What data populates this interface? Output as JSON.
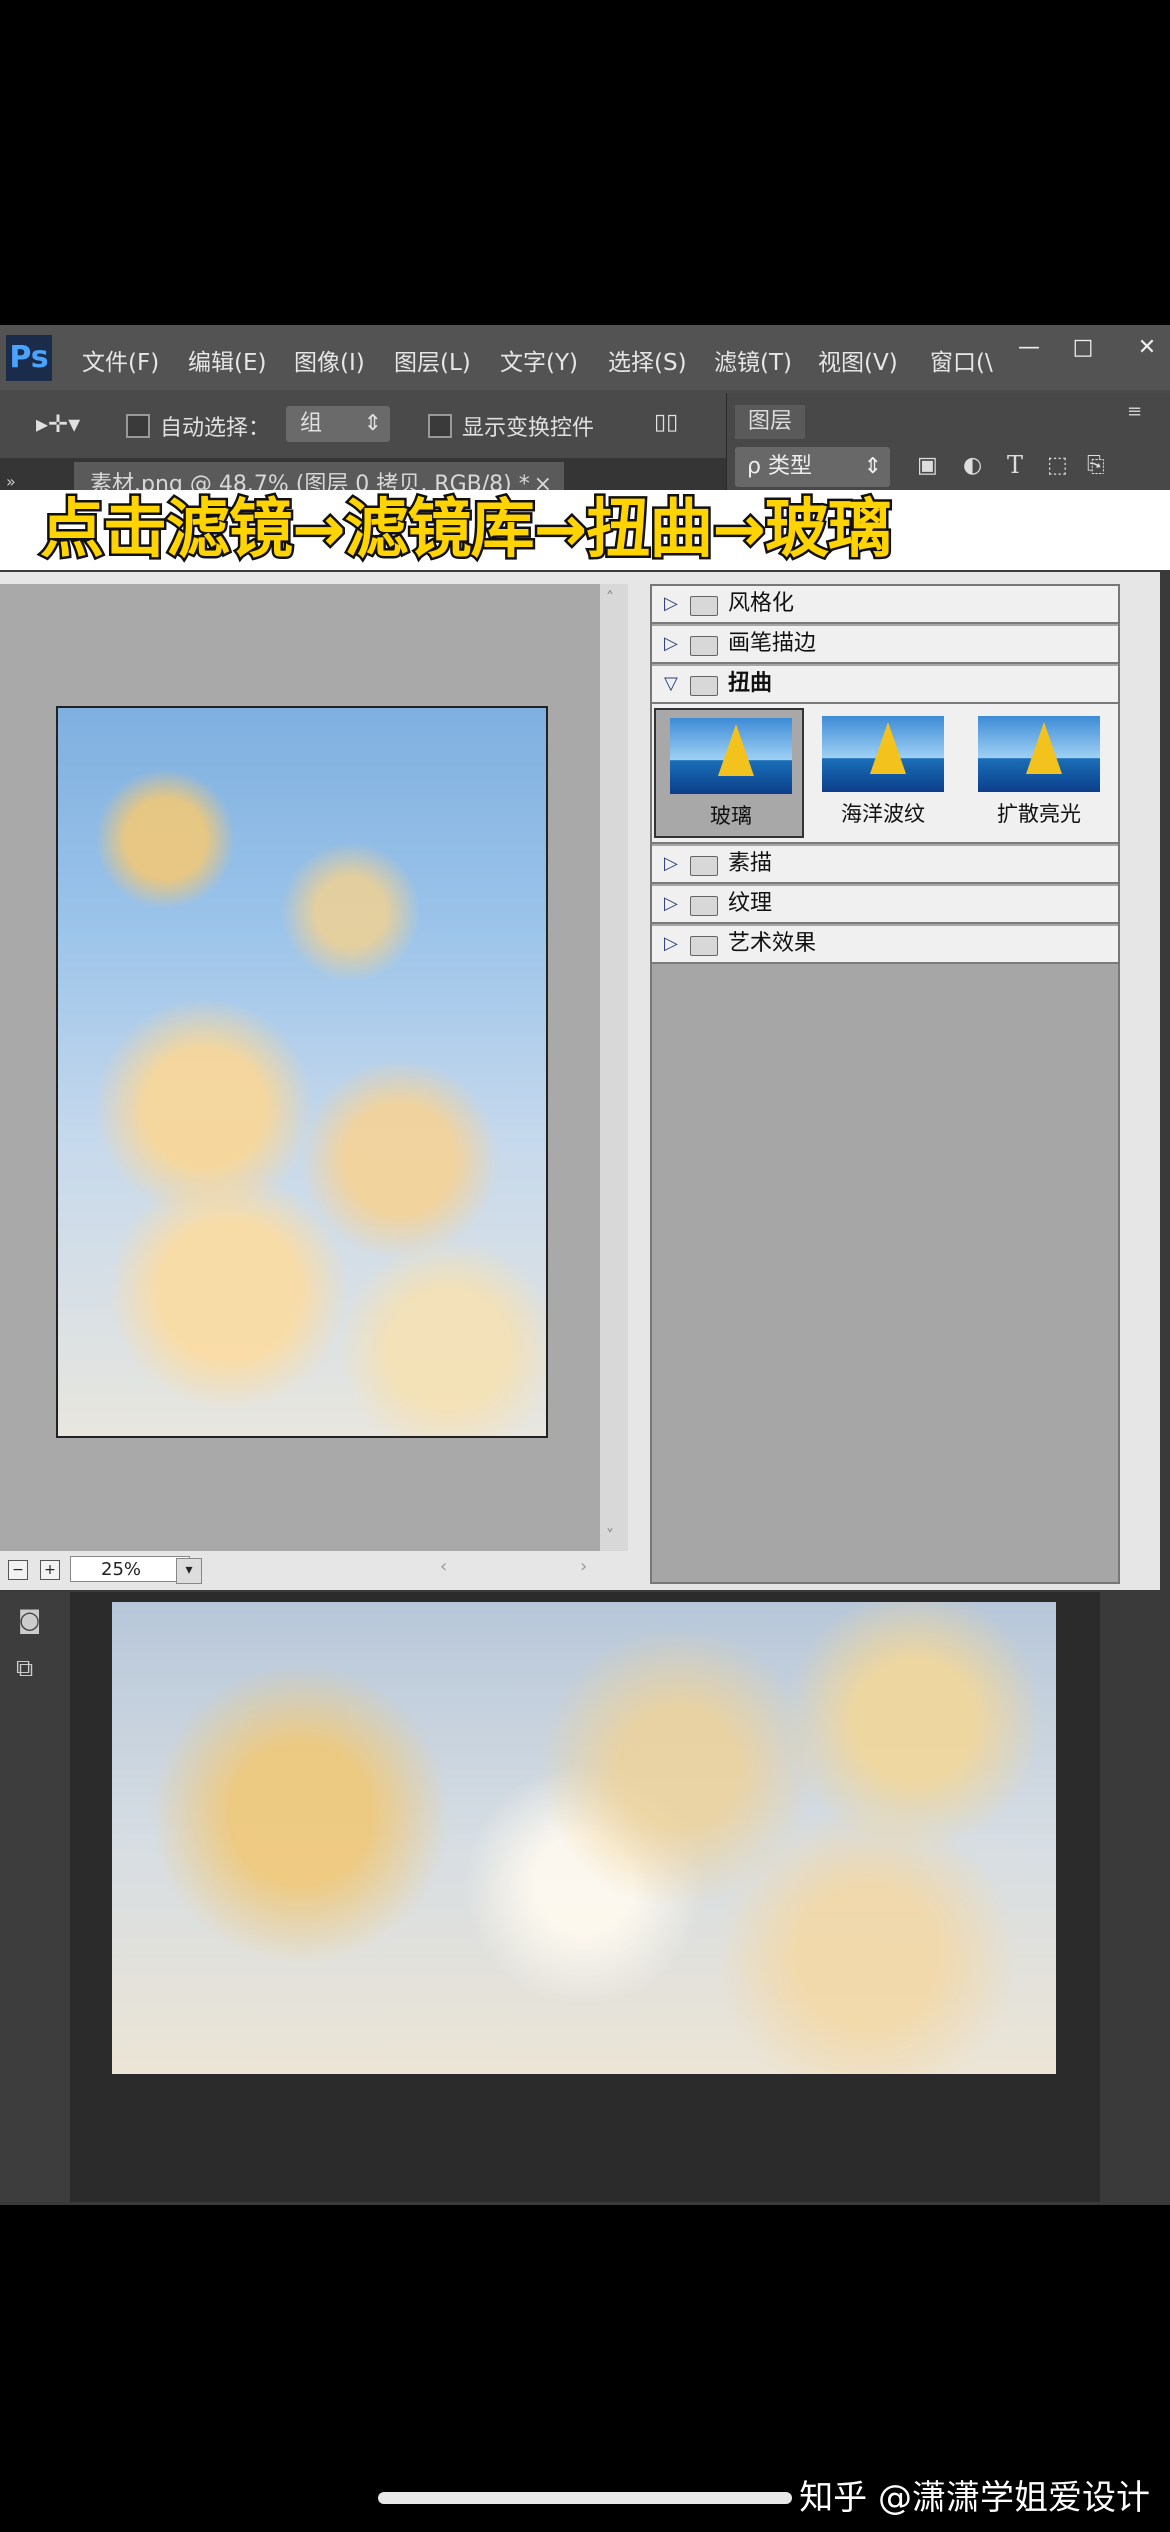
{
  "app": {
    "logo": "Ps",
    "menu": [
      "文件(F)",
      "编辑(E)",
      "图像(I)",
      "图层(L)",
      "文字(Y)",
      "选择(S)",
      "滤镜(T)",
      "视图(V)",
      "窗口(\\"
    ],
    "window_controls": {
      "minimize": "—",
      "maximize": "□",
      "close": "✕"
    }
  },
  "options_bar": {
    "auto_select_label": "自动选择：",
    "auto_select_value": "组",
    "show_transform_label": "显示变换控件"
  },
  "document_tab": {
    "label": "素材.png @ 48.7% (图层 0 拷贝, RGB/8) *",
    "close": "×"
  },
  "layers_panel": {
    "tab": "图层",
    "kind_filter": "ρ 类型"
  },
  "caption": {
    "text": "点击滤镜→滤镜库→扭曲→玻璃",
    "left_cut": "玻璃"
  },
  "filter_gallery": {
    "zoom": "25%",
    "categories_top": [
      "风格化",
      "画笔描边"
    ],
    "open_category": "扭曲",
    "filters": [
      {
        "label": "玻璃",
        "selected": true
      },
      {
        "label": "海洋波纹",
        "selected": false
      },
      {
        "label": "扩散亮光",
        "selected": false
      }
    ],
    "categories_bottom": [
      "素描",
      "纹理",
      "艺术效果"
    ]
  },
  "watermark": "知乎 @潇潇学姐爱设计",
  "colors": {
    "caption_yellow": "#ffd400",
    "ps_blue": "#4aa3ff"
  }
}
